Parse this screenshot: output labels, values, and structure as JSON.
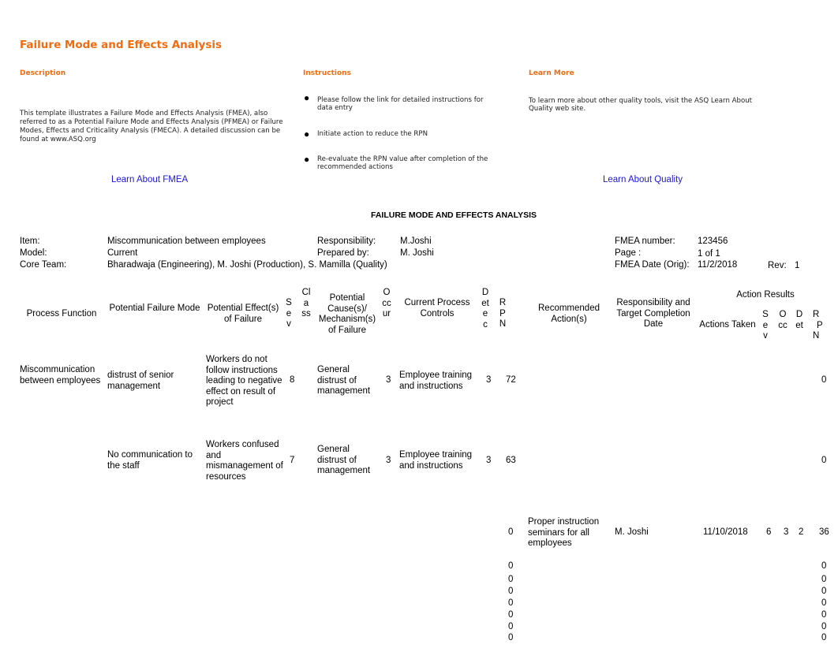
{
  "header": {
    "title": "Failure Mode and Effects Analysis",
    "description_heading": "Description",
    "description_text": "This template illustrates a Failure Mode and Effects Analysis (FMEA), also referred to as a Potential Failure Mode and Effects Analysis (PFMEA) or Failure Modes, Effects and Criticality Analysis (FMECA).  A detailed discussion can be found at www.ASQ.org",
    "learn_fmea_link": "Learn About FMEA",
    "instructions_heading": "Instructions",
    "instructions": [
      "Please follow the link for detailed instructions for data entry",
      "Initiate action to reduce the RPN",
      "Re-evaluate the RPN value after completion of the recommended actions"
    ],
    "learn_more_heading": "Learn More",
    "learn_more_text": "To learn more about other quality tools, visit the ASQ Learn About Quality web site.",
    "learn_quality_link": "Learn About Quality",
    "bullet_icon": "●"
  },
  "sheet": {
    "title": "FAILURE MODE AND EFFECTS ANALYSIS",
    "item_label": "Item:",
    "item_value": "Miscommunication between employees",
    "model_label": "Model:",
    "model_value": "Current",
    "core_team_label": "Core Team:",
    "core_team_value": "Bharadwaja (Engineering), M. Joshi (Production), S. Mamilla (Quality)",
    "responsibility_label": "Responsibility:",
    "responsibility_value": "M.Joshi",
    "prepared_by_label": "Prepared by:",
    "prepared_by_value": "M. Joshi",
    "fmea_number_label": "FMEA number:",
    "fmea_number_value": "123456",
    "page_label": "Page :",
    "page_value": "1 of 1",
    "fmea_date_label": "FMEA Date (Orig):",
    "fmea_date_value": "11/2/2018",
    "rev_label": "Rev:",
    "rev_value": "1"
  },
  "columns": {
    "process_function": "Process Function",
    "failure_mode": "Potential Failure Mode",
    "effects": "Potential Effect(s) of Failure",
    "sev": "Sev",
    "class": "Class",
    "causes": "Potential Cause(s)/ Mechanism(s) of Failure",
    "occur": "Occur",
    "controls": "Current Process Controls",
    "detec": "Detec",
    "rpn": "RPN",
    "recommended": "Recommended Action(s)",
    "responsibility": "Responsibility and Target Completion Date",
    "action_results": "Action Results",
    "actions_taken": "Actions Taken",
    "res_sev": "Sev",
    "res_occ": "Occ",
    "res_det": "Det",
    "res_rpn": "RPN"
  },
  "rows": [
    {
      "process_function": "Miscommunication between employees",
      "failure_mode": "distrust of senior management",
      "effects": "Workers do not follow instructions leading to negative effect on result of project",
      "sev": "8",
      "causes": "General distrust of management",
      "occur": "3",
      "controls": "Employee training and instructions",
      "detec": "3",
      "rpn": "72",
      "res_rpn": "0"
    },
    {
      "process_function": "",
      "failure_mode": "No communication to the staff",
      "effects": "Workers confused and mismanagement of resources",
      "sev": "7",
      "causes": "General distrust of management",
      "occur": "3",
      "controls": "Employee training and instructions",
      "detec": "3",
      "rpn": "63",
      "res_rpn": "0"
    },
    {
      "rpn": "0",
      "recommended": "Proper instruction seminars for all employees",
      "responsibility": "M. Joshi",
      "actions_taken": "11/10/2018",
      "res_sev": "6",
      "res_occ": "3",
      "res_det": "2",
      "res_rpn": "36"
    }
  ],
  "empty_rows": [
    {
      "rpn": "0",
      "res_rpn": "0"
    },
    {
      "rpn": "0",
      "res_rpn": "0"
    },
    {
      "rpn": "0",
      "res_rpn": "0"
    },
    {
      "rpn": "0",
      "res_rpn": "0"
    },
    {
      "rpn": "0",
      "res_rpn": "0"
    },
    {
      "rpn": "0",
      "res_rpn": "0"
    },
    {
      "rpn": "0",
      "res_rpn": "0"
    }
  ]
}
